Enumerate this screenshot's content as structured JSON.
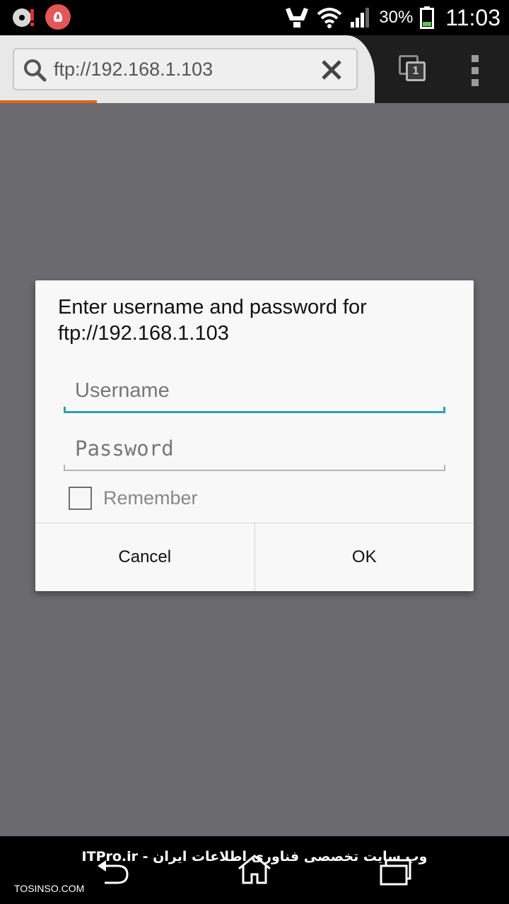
{
  "status_bar": {
    "notification_badge": "۵",
    "battery_percent": "30%",
    "time": "11:03"
  },
  "browser": {
    "url": "ftp://192.168.1.103",
    "tab_count": "1",
    "progress": 0.19
  },
  "dialog": {
    "title": "Enter username and password for ftp://192.168.1.103",
    "username_placeholder": "Username",
    "password_placeholder": "Password",
    "remember_label": "Remember",
    "remember_checked": false,
    "cancel_label": "Cancel",
    "ok_label": "OK"
  },
  "watermark": {
    "site_text": "ITPro.ir - وب سایت تخصصی فناوری اطلاعات ایران",
    "corner_text": "TOSINSO.COM"
  },
  "colors": {
    "accent": "#2aa1b3",
    "progress": "#e0661b",
    "scrim": "#6b6a6d"
  },
  "icons": [
    "cd-icon",
    "notification-badge-icon",
    "signal-booster-icon",
    "wifi-icon",
    "cell-signal-icon",
    "battery-icon",
    "search-icon",
    "clear-icon",
    "tabs-icon",
    "overflow-menu-icon",
    "back-icon",
    "home-icon",
    "recent-apps-icon"
  ]
}
